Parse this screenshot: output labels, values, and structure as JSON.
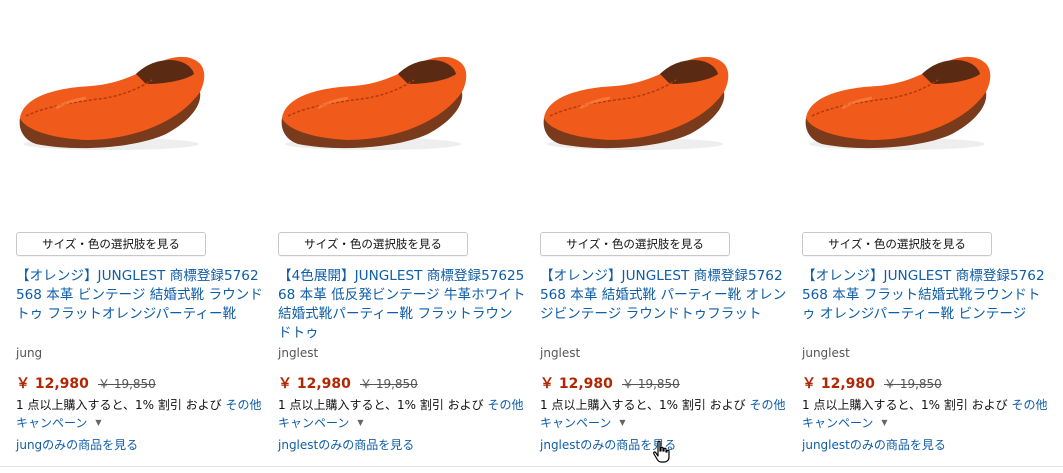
{
  "products": [
    {
      "variant_button": "サイズ・色の選択肢を見る",
      "title": "【オレンジ】JUNGLEST 商標登録5762568 本革 ビンテージ 結婚式靴 ラウンドトゥ フラットオレンジパーティー靴",
      "brand": "jung",
      "price": "￥ 12,980",
      "old_price": "￥ 19,850",
      "promo_text": "1 点以上購入すると、1% 割引 および",
      "promo_link": "その他キャンペーン",
      "store_link": "jungのみの商品を見る",
      "image_icon": "orange-loafer-shoe"
    },
    {
      "variant_button": "サイズ・色の選択肢を見る",
      "title": "【4色展開】JUNGLEST 商標登録5762568 本革 低反発ビンテージ 牛革ホワイト結婚式靴パーティー靴 フラットラウンドトゥ",
      "brand": "jnglest",
      "price": "￥ 12,980",
      "old_price": "￥ 19,850",
      "promo_text": "1 点以上購入すると、1% 割引 および",
      "promo_link": "その他キャンペーン",
      "store_link": "jnglestのみの商品を見る",
      "image_icon": "orange-loafer-shoe"
    },
    {
      "variant_button": "サイズ・色の選択肢を見る",
      "title": "【オレンジ】JUNGLEST 商標登録5762568 本革 結婚式靴 パーティー靴 オレンジビンテージ ラウンドトゥフラット",
      "brand": "jnglest",
      "price": "￥ 12,980",
      "old_price": "￥ 19,850",
      "promo_text": "1 点以上購入すると、1% 割引 および",
      "promo_link": "その他キャンペーン",
      "store_link": "jnglestのみの商品を見る",
      "image_icon": "orange-loafer-shoe"
    },
    {
      "variant_button": "サイズ・色の選択肢を見る",
      "title": "【オレンジ】JUNGLEST 商標登録5762568 本革 フラット結婚式靴ラウンドトゥ オレンジパーティー靴 ビンテージ",
      "brand": "junglest",
      "price": "￥ 12,980",
      "old_price": "￥ 19,850",
      "promo_text": "1 点以上購入すると、1% 割引 および",
      "promo_link": "その他キャンペーン",
      "store_link": "junglestのみの商品を見る",
      "image_icon": "orange-loafer-shoe"
    }
  ],
  "colors": {
    "link": "#0f5da8",
    "price": "#b12704",
    "shoe": "#f05a1a"
  },
  "cursor_icon": "hand-pointer-icon"
}
